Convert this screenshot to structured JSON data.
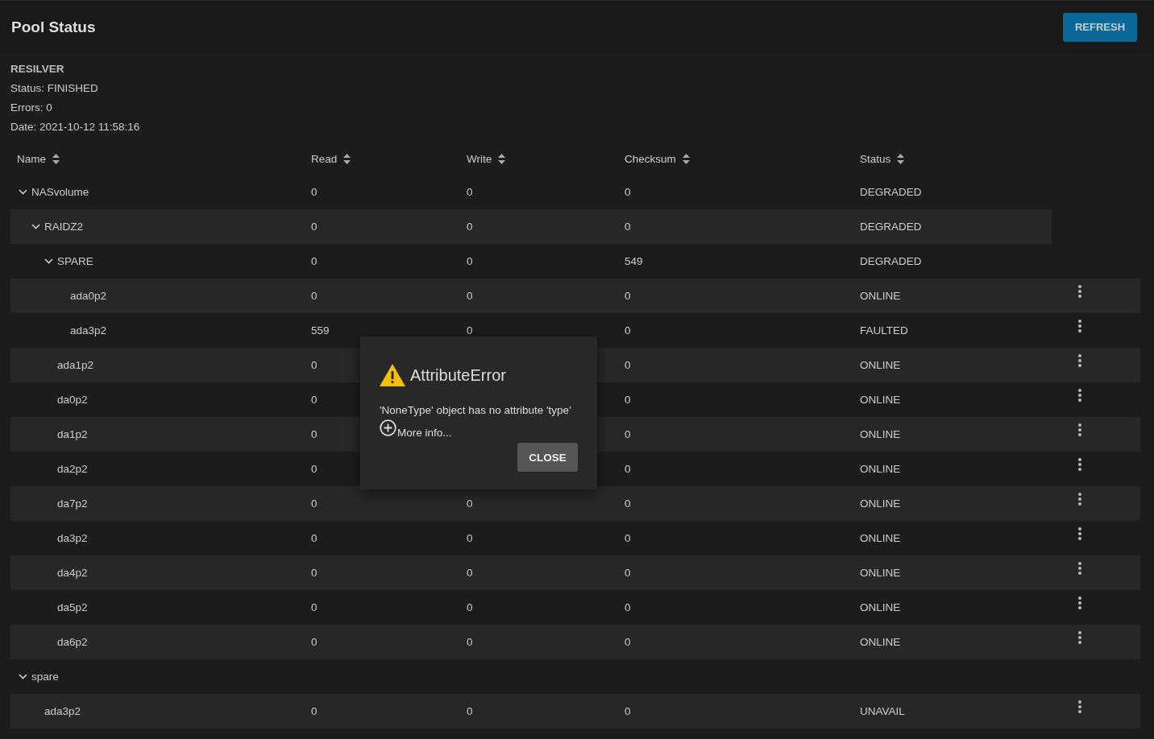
{
  "header": {
    "title": "Pool Status",
    "refresh_button": "REFRESH"
  },
  "resilver": {
    "heading": "RESILVER",
    "lines": [
      "Status: FINISHED",
      "Errors: 0",
      "Date: 2021-10-12 11:58:16"
    ]
  },
  "table": {
    "columns": [
      {
        "label": "Name"
      },
      {
        "label": "Read"
      },
      {
        "label": "Write"
      },
      {
        "label": "Checksum"
      },
      {
        "label": "Status"
      }
    ],
    "rows": [
      {
        "name": "NASvolume",
        "read": "0",
        "write": "0",
        "checksum": "0",
        "status": "DEGRADED",
        "expanded": true,
        "children": [
          {
            "name": "RAIDZ2",
            "read": "0",
            "write": "0",
            "checksum": "0",
            "status": "DEGRADED",
            "expanded": true,
            "children": [
              {
                "name": "SPARE",
                "read": "0",
                "write": "0",
                "checksum": "549",
                "status": "DEGRADED",
                "expanded": true,
                "children": [
                  {
                    "name": "ada0p2",
                    "read": "0",
                    "write": "0",
                    "checksum": "0",
                    "status": "ONLINE"
                  },
                  {
                    "name": "ada3p2",
                    "read": "559",
                    "write": "0",
                    "checksum": "0",
                    "status": "FAULTED"
                  }
                ]
              },
              {
                "name": "ada1p2",
                "read": "0",
                "checksum": "0",
                "status": "ONLINE"
              },
              {
                "name": "da0p2",
                "read": "0",
                "checksum": "0",
                "status": "ONLINE"
              },
              {
                "name": "da1p2",
                "read": "0",
                "checksum": "0",
                "status": "ONLINE"
              },
              {
                "name": "da2p2",
                "read": "0",
                "checksum": "0",
                "status": "ONLINE"
              },
              {
                "name": "da7p2",
                "read": "0",
                "write": "0",
                "checksum": "0",
                "status": "ONLINE"
              },
              {
                "name": "da3p2",
                "read": "0",
                "write": "0",
                "checksum": "0",
                "status": "ONLINE"
              },
              {
                "name": "da4p2",
                "read": "0",
                "write": "0",
                "checksum": "0",
                "status": "ONLINE"
              },
              {
                "name": "da5p2",
                "read": "0",
                "write": "0",
                "checksum": "0",
                "status": "ONLINE"
              },
              {
                "name": "da6p2",
                "read": "0",
                "write": "0",
                "checksum": "0",
                "status": "ONLINE"
              }
            ]
          }
        ]
      },
      {
        "name": "spare",
        "expanded": true,
        "children": [
          {
            "name": "ada3p2",
            "read": "0",
            "write": "0",
            "checksum": "0",
            "status": "UNAVAIL"
          }
        ]
      }
    ]
  },
  "dialog": {
    "title": "AttributeError",
    "message": "'NoneType' object has no attribute 'type'",
    "more_info": "More info...",
    "close_button": "CLOSE"
  }
}
